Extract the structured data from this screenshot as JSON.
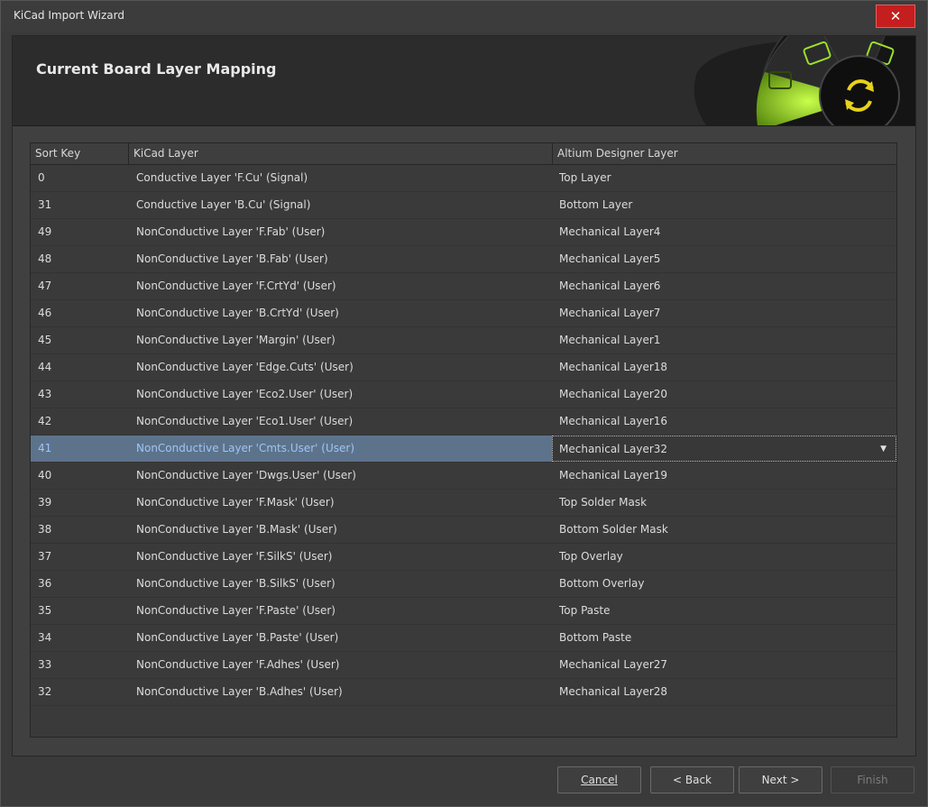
{
  "window": {
    "title": "KiCad Import Wizard",
    "close_label": "✕"
  },
  "header": {
    "title": "Current Board Layer Mapping",
    "art_icon": "refresh-icon"
  },
  "table": {
    "columns": [
      "Sort Key",
      "KiCad Layer",
      "Altium Designer Layer"
    ],
    "rows": [
      {
        "key": "0",
        "kicad": "Conductive Layer 'F.Cu' (Signal)",
        "altium": "Top Layer"
      },
      {
        "key": "31",
        "kicad": "Conductive Layer 'B.Cu' (Signal)",
        "altium": "Bottom Layer"
      },
      {
        "key": "49",
        "kicad": "NonConductive Layer 'F.Fab' (User)",
        "altium": "Mechanical Layer4"
      },
      {
        "key": "48",
        "kicad": "NonConductive Layer 'B.Fab' (User)",
        "altium": "Mechanical Layer5"
      },
      {
        "key": "47",
        "kicad": "NonConductive Layer 'F.CrtYd' (User)",
        "altium": "Mechanical Layer6"
      },
      {
        "key": "46",
        "kicad": "NonConductive Layer 'B.CrtYd' (User)",
        "altium": "Mechanical Layer7"
      },
      {
        "key": "45",
        "kicad": "NonConductive Layer 'Margin' (User)",
        "altium": "Mechanical Layer1"
      },
      {
        "key": "44",
        "kicad": "NonConductive Layer 'Edge.Cuts' (User)",
        "altium": "Mechanical Layer18"
      },
      {
        "key": "43",
        "kicad": "NonConductive Layer 'Eco2.User' (User)",
        "altium": "Mechanical Layer20"
      },
      {
        "key": "42",
        "kicad": "NonConductive Layer 'Eco1.User' (User)",
        "altium": "Mechanical Layer16"
      },
      {
        "key": "41",
        "kicad": "NonConductive Layer 'Cmts.User' (User)",
        "altium": "Mechanical Layer32"
      },
      {
        "key": "40",
        "kicad": "NonConductive Layer 'Dwgs.User' (User)",
        "altium": "Mechanical Layer19"
      },
      {
        "key": "39",
        "kicad": "NonConductive Layer 'F.Mask' (User)",
        "altium": "Top Solder Mask"
      },
      {
        "key": "38",
        "kicad": "NonConductive Layer 'B.Mask' (User)",
        "altium": "Bottom Solder Mask"
      },
      {
        "key": "37",
        "kicad": "NonConductive Layer 'F.SilkS' (User)",
        "altium": "Top Overlay"
      },
      {
        "key": "36",
        "kicad": "NonConductive Layer 'B.SilkS' (User)",
        "altium": "Bottom Overlay"
      },
      {
        "key": "35",
        "kicad": "NonConductive Layer 'F.Paste' (User)",
        "altium": "Top Paste"
      },
      {
        "key": "34",
        "kicad": "NonConductive Layer 'B.Paste' (User)",
        "altium": "Bottom Paste"
      },
      {
        "key": "33",
        "kicad": "NonConductive Layer 'F.Adhes' (User)",
        "altium": "Mechanical Layer27"
      },
      {
        "key": "32",
        "kicad": "NonConductive Layer 'B.Adhes' (User)",
        "altium": "Mechanical Layer28"
      }
    ],
    "selected_row": 10,
    "dropdown_icon": "chevron-down-icon",
    "dropdown_glyph": "▼"
  },
  "footer": {
    "cancel": "Cancel",
    "back": "< Back",
    "next": "Next >",
    "finish": "Finish"
  },
  "colors": {
    "selection": "#5d738c",
    "selected_text": "#9ec6f2",
    "close_button": "#c41e1e",
    "accent_green": "#9be02a"
  }
}
